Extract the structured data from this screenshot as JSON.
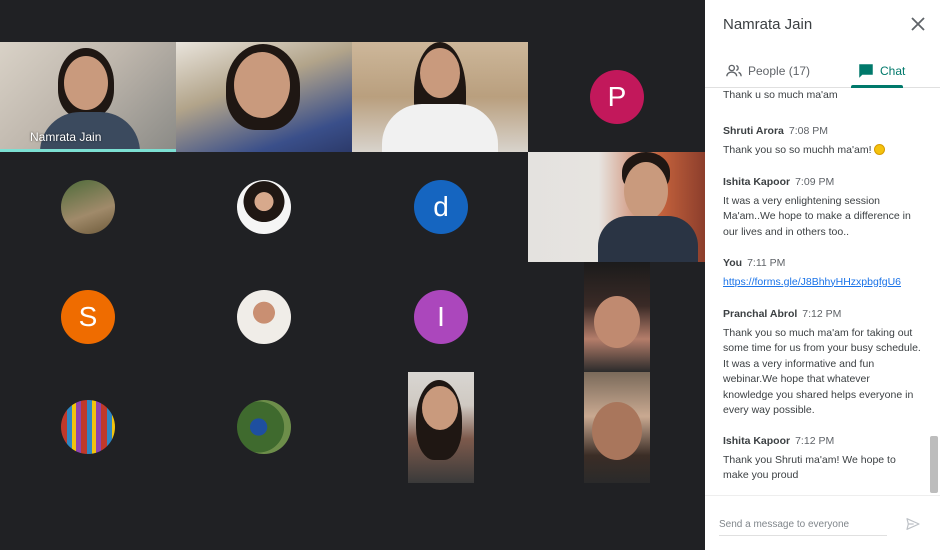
{
  "panel": {
    "title": "Namrata Jain",
    "tabs": [
      {
        "label": "People (17)",
        "icon": "people-icon"
      },
      {
        "label": "Chat",
        "icon": "chat-icon",
        "active": true
      }
    ]
  },
  "grid": {
    "self_name": "Namrata Jain",
    "avatar_letters": [
      "P",
      "d",
      "S",
      "I"
    ]
  },
  "messages": [
    {
      "sender": "",
      "time": "",
      "text": "Thank u so much ma'am"
    },
    {
      "sender": "Shruti Arora",
      "time": "7:08 PM",
      "text": "Thank you so so muchh ma'am!"
    },
    {
      "sender": "Ishita Kapoor",
      "time": "7:09 PM",
      "text": "It was a very enlightening session Ma'am..We hope to make a difference in our lives and in others too.."
    },
    {
      "sender": "You",
      "time": "7:11 PM",
      "text": "https://forms.gle/J8BhhyHHzxpbgfgU6"
    },
    {
      "sender": "Pranchal Abrol",
      "time": "7:12 PM",
      "text": "Thank you so much ma'am for taking out some time for us from your busy schedule. It was a very informative and fun webinar.We hope that whatever knowledge you shared helps everyone in every way possible."
    },
    {
      "sender": "Ishita Kapoor",
      "time": "7:12 PM",
      "text": "Thank you Shruti ma'am! We hope to make you proud"
    }
  ],
  "composer": {
    "placeholder": "Send a message to everyone"
  },
  "colors": {
    "accent": "#00796b",
    "link": "#1a73e8",
    "avatar_p": "#c2185b",
    "avatar_d": "#1565c0",
    "avatar_s": "#ef6c00",
    "avatar_i": "#ab47bc"
  }
}
